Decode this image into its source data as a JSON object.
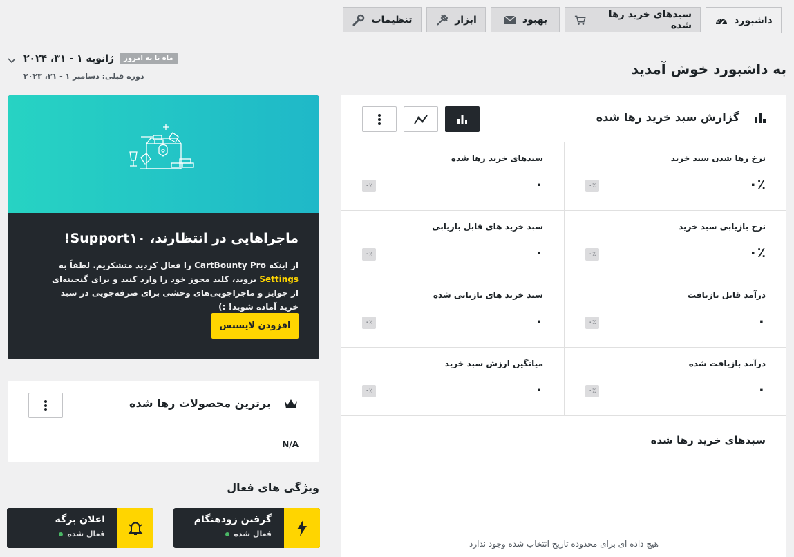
{
  "tabs": [
    {
      "label": "داشبورد",
      "icon": "gauge-icon",
      "active": true
    },
    {
      "label": "سبدهای خرید رها شده",
      "icon": "cart-icon"
    },
    {
      "label": "بهبود",
      "icon": "envelope-icon"
    },
    {
      "label": "ابزار",
      "icon": "tools-icon"
    },
    {
      "label": "تنظیمات",
      "icon": "wrench-icon"
    }
  ],
  "date_range": {
    "badge": "ماه تا به امروز",
    "current": "ژانویه ۱ - ۳۱، ۲۰۲۴",
    "previous": "دوره قبلی: دسامبر ۱ - ۳۱، ۲۰۲۳"
  },
  "welcome": "به داشبورد خوش آمدید",
  "promo": {
    "title": "ماجراهایی در انتظارند، Support۱۰!",
    "text_before": "از اینکه CartBounty Pro را فعال کردید متشکریم. لطفاً به ",
    "link": "Settings",
    "text_after": " بروید، کلید مجوز خود را وارد کنید و برای گنجینه‌ای از جوایز و ماجراجویی‌های وحشی برای صرفه‌جویی در سبد خرید آماده شوید! :)",
    "button": "افزودن لایسنس"
  },
  "top_products": {
    "title": "برترین محصولات رها شده",
    "empty": "N/A"
  },
  "features": {
    "title": "ویژگی های فعال",
    "items": [
      {
        "title": "گرفتن زودهنگام",
        "status": "فعال شده",
        "icon": "lightning-icon"
      },
      {
        "title": "اعلان برگه",
        "status": "فعال شده",
        "icon": "bell-icon"
      }
    ]
  },
  "report": {
    "title": "گزارش سبد خرید رها شده",
    "stats": [
      {
        "label": "نرخ رها شدن سبد خرید",
        "value": "۰٪",
        "badge": "۰٪"
      },
      {
        "label": "سبدهای خرید رها شده",
        "value": "۰",
        "badge": "۰٪"
      },
      {
        "label": "نرخ بازیابی سبد خرید",
        "value": "۰٪",
        "badge": "۰٪"
      },
      {
        "label": "سبد خرید های قابل بازیابی",
        "value": "۰",
        "badge": "۰٪"
      },
      {
        "label": "درآمد قابل بازیافت",
        "value": "۰",
        "badge": "۰٪"
      },
      {
        "label": "سبد خرید های بازیابی شده",
        "value": "۰",
        "badge": "۰٪"
      },
      {
        "label": "درآمد بازیافت شده",
        "value": "۰",
        "badge": "۰٪"
      },
      {
        "label": "میانگین ارزش سبد خرید",
        "value": "۰",
        "badge": "۰٪"
      }
    ],
    "chart_title": "سبدهای خرید رها شده",
    "chart_empty": "هیچ داده ای برای محدوده تاریخ انتخاب شده وجود ندارد"
  },
  "colors": {
    "accent": "#ffd500",
    "dark": "#23282d",
    "teal": "#27d3c3",
    "success": "#4ab866"
  }
}
